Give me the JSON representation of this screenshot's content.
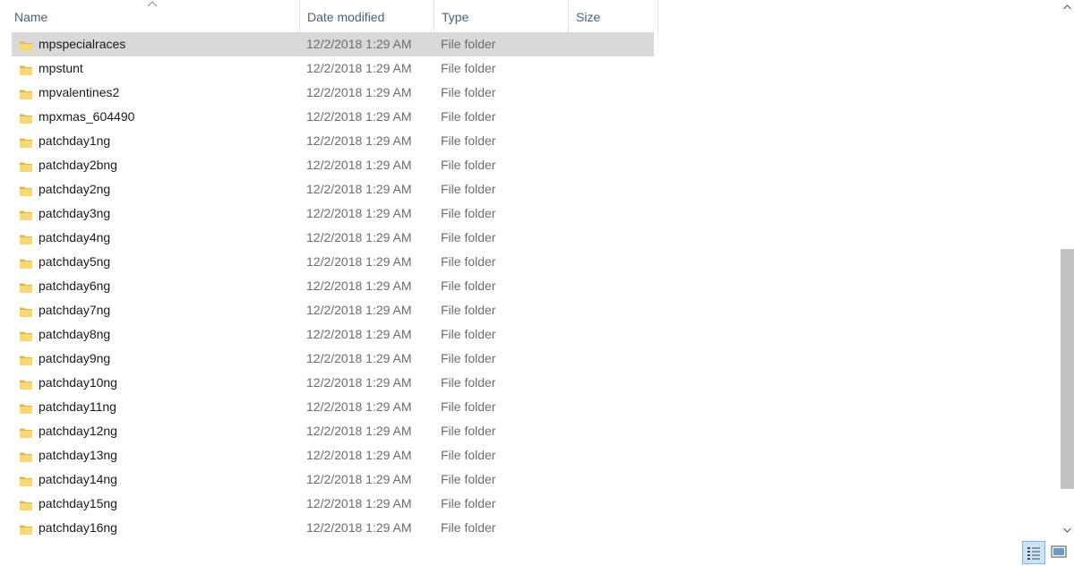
{
  "columns": {
    "name": "Name",
    "date_modified": "Date modified",
    "type": "Type",
    "size": "Size"
  },
  "icons": {
    "folder": "folder-icon",
    "sort": "sort-ascending-icon",
    "details_view": "details-view-icon",
    "tiles_view": "large-icons-view-icon"
  },
  "colors": {
    "folder_yellow": "#f8d775",
    "folder_dark": "#e2b844",
    "selected_row": "#d9d9d9",
    "header_text": "#4c607a",
    "accent": "#7eb4ea"
  },
  "files": [
    {
      "name": "mpspecialraces",
      "date": "12/2/2018 1:29 AM",
      "type": "File folder",
      "selected": true
    },
    {
      "name": "mpstunt",
      "date": "12/2/2018 1:29 AM",
      "type": "File folder"
    },
    {
      "name": "mpvalentines2",
      "date": "12/2/2018 1:29 AM",
      "type": "File folder"
    },
    {
      "name": "mpxmas_604490",
      "date": "12/2/2018 1:29 AM",
      "type": "File folder"
    },
    {
      "name": "patchday1ng",
      "date": "12/2/2018 1:29 AM",
      "type": "File folder"
    },
    {
      "name": "patchday2bng",
      "date": "12/2/2018 1:29 AM",
      "type": "File folder"
    },
    {
      "name": "patchday2ng",
      "date": "12/2/2018 1:29 AM",
      "type": "File folder"
    },
    {
      "name": "patchday3ng",
      "date": "12/2/2018 1:29 AM",
      "type": "File folder"
    },
    {
      "name": "patchday4ng",
      "date": "12/2/2018 1:29 AM",
      "type": "File folder"
    },
    {
      "name": "patchday5ng",
      "date": "12/2/2018 1:29 AM",
      "type": "File folder"
    },
    {
      "name": "patchday6ng",
      "date": "12/2/2018 1:29 AM",
      "type": "File folder"
    },
    {
      "name": "patchday7ng",
      "date": "12/2/2018 1:29 AM",
      "type": "File folder"
    },
    {
      "name": "patchday8ng",
      "date": "12/2/2018 1:29 AM",
      "type": "File folder"
    },
    {
      "name": "patchday9ng",
      "date": "12/2/2018 1:29 AM",
      "type": "File folder"
    },
    {
      "name": "patchday10ng",
      "date": "12/2/2018 1:29 AM",
      "type": "File folder"
    },
    {
      "name": "patchday11ng",
      "date": "12/2/2018 1:29 AM",
      "type": "File folder"
    },
    {
      "name": "patchday12ng",
      "date": "12/2/2018 1:29 AM",
      "type": "File folder"
    },
    {
      "name": "patchday13ng",
      "date": "12/2/2018 1:29 AM",
      "type": "File folder"
    },
    {
      "name": "patchday14ng",
      "date": "12/2/2018 1:29 AM",
      "type": "File folder"
    },
    {
      "name": "patchday15ng",
      "date": "12/2/2018 1:29 AM",
      "type": "File folder"
    },
    {
      "name": "patchday16ng",
      "date": "12/2/2018 1:29 AM",
      "type": "File folder"
    }
  ]
}
